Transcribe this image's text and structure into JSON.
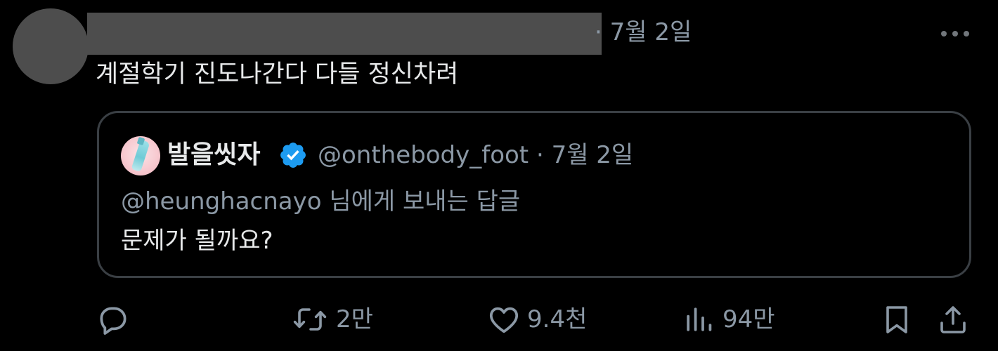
{
  "post": {
    "time": "· 7월 2일",
    "text": "계절학기 진도나간다 다들 정신차려"
  },
  "quote": {
    "display_name": "발을씻자",
    "handle_time": "@onthebody_foot · 7월 2일",
    "reply_to": "@heunghacnayo 님에게 보내는 답글",
    "text": "문제가 될까요?"
  },
  "actions": {
    "reply_icon": "reply-icon",
    "retweet_count": "2만",
    "like_count": "9.4천",
    "views_count": "94만",
    "bookmark_icon": "bookmark-icon",
    "share_icon": "share-icon"
  },
  "colors": {
    "background": "#000000",
    "text_primary": "#e7e9ea",
    "text_secondary": "#8b98a5",
    "verified_blue": "#1d9bf0",
    "card_border": "#3a3f44",
    "redaction_gray": "#4d4d4d"
  }
}
